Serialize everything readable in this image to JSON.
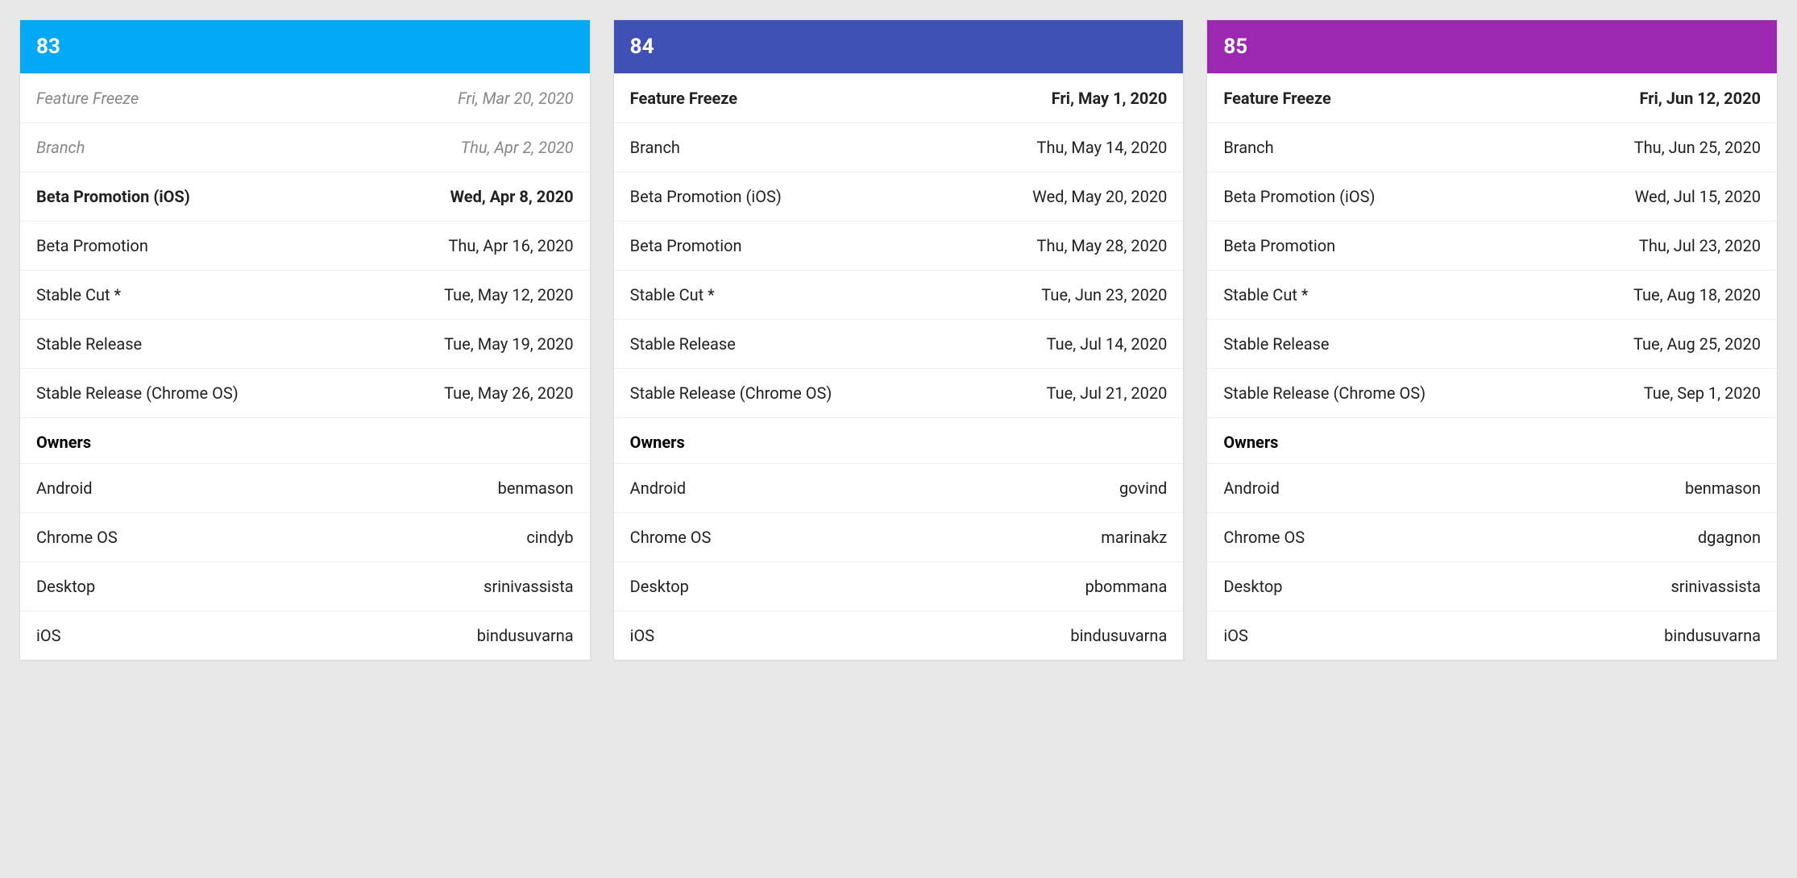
{
  "releases": [
    {
      "version": "83",
      "header_color": "#03A9F4",
      "milestones": [
        {
          "label": "Feature Freeze",
          "date": "Fri, Mar 20, 2020",
          "style": "muted"
        },
        {
          "label": "Branch",
          "date": "Thu, Apr 2, 2020",
          "style": "muted"
        },
        {
          "label": "Beta Promotion (iOS)",
          "date": "Wed, Apr 8, 2020",
          "style": "bold"
        },
        {
          "label": "Beta Promotion",
          "date": "Thu, Apr 16, 2020",
          "style": "normal"
        },
        {
          "label": "Stable Cut *",
          "date": "Tue, May 12, 2020",
          "style": "normal"
        },
        {
          "label": "Stable Release",
          "date": "Tue, May 19, 2020",
          "style": "normal"
        },
        {
          "label": "Stable Release (Chrome OS)",
          "date": "Tue, May 26, 2020",
          "style": "normal"
        }
      ],
      "owners_title": "Owners",
      "owners": [
        {
          "platform": "Android",
          "name": "benmason"
        },
        {
          "platform": "Chrome OS",
          "name": "cindyb"
        },
        {
          "platform": "Desktop",
          "name": "srinivassista"
        },
        {
          "platform": "iOS",
          "name": "bindusuvarna"
        }
      ]
    },
    {
      "version": "84",
      "header_color": "#3F51B5",
      "milestones": [
        {
          "label": "Feature Freeze",
          "date": "Fri, May 1, 2020",
          "style": "bold"
        },
        {
          "label": "Branch",
          "date": "Thu, May 14, 2020",
          "style": "normal"
        },
        {
          "label": "Beta Promotion (iOS)",
          "date": "Wed, May 20, 2020",
          "style": "normal"
        },
        {
          "label": "Beta Promotion",
          "date": "Thu, May 28, 2020",
          "style": "normal"
        },
        {
          "label": "Stable Cut *",
          "date": "Tue, Jun 23, 2020",
          "style": "normal"
        },
        {
          "label": "Stable Release",
          "date": "Tue, Jul 14, 2020",
          "style": "normal"
        },
        {
          "label": "Stable Release (Chrome OS)",
          "date": "Tue, Jul 21, 2020",
          "style": "normal"
        }
      ],
      "owners_title": "Owners",
      "owners": [
        {
          "platform": "Android",
          "name": "govind"
        },
        {
          "platform": "Chrome OS",
          "name": "marinakz"
        },
        {
          "platform": "Desktop",
          "name": "pbommana"
        },
        {
          "platform": "iOS",
          "name": "bindusuvarna"
        }
      ]
    },
    {
      "version": "85",
      "header_color": "#9C27B0",
      "milestones": [
        {
          "label": "Feature Freeze",
          "date": "Fri, Jun 12, 2020",
          "style": "bold"
        },
        {
          "label": "Branch",
          "date": "Thu, Jun 25, 2020",
          "style": "normal"
        },
        {
          "label": "Beta Promotion (iOS)",
          "date": "Wed, Jul 15, 2020",
          "style": "normal"
        },
        {
          "label": "Beta Promotion",
          "date": "Thu, Jul 23, 2020",
          "style": "normal"
        },
        {
          "label": "Stable Cut *",
          "date": "Tue, Aug 18, 2020",
          "style": "normal"
        },
        {
          "label": "Stable Release",
          "date": "Tue, Aug 25, 2020",
          "style": "normal"
        },
        {
          "label": "Stable Release (Chrome OS)",
          "date": "Tue, Sep 1, 2020",
          "style": "normal"
        }
      ],
      "owners_title": "Owners",
      "owners": [
        {
          "platform": "Android",
          "name": "benmason"
        },
        {
          "platform": "Chrome OS",
          "name": "dgagnon"
        },
        {
          "platform": "Desktop",
          "name": "srinivassista"
        },
        {
          "platform": "iOS",
          "name": "bindusuvarna"
        }
      ]
    }
  ]
}
